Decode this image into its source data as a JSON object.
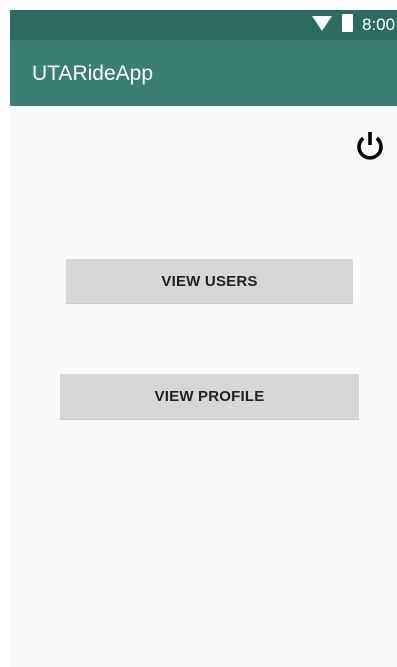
{
  "status_bar": {
    "time": "8:00",
    "wifi_icon": "wifi-icon",
    "battery_icon": "battery-icon",
    "color": "#2b6b60"
  },
  "app_bar": {
    "title": "UTARideApp",
    "color": "#3a7f74"
  },
  "actions": {
    "power_icon": "power-icon"
  },
  "buttons": {
    "view_users_label": "VIEW USERS",
    "view_profile_label": "VIEW PROFILE",
    "background": "#d6d7d7"
  }
}
